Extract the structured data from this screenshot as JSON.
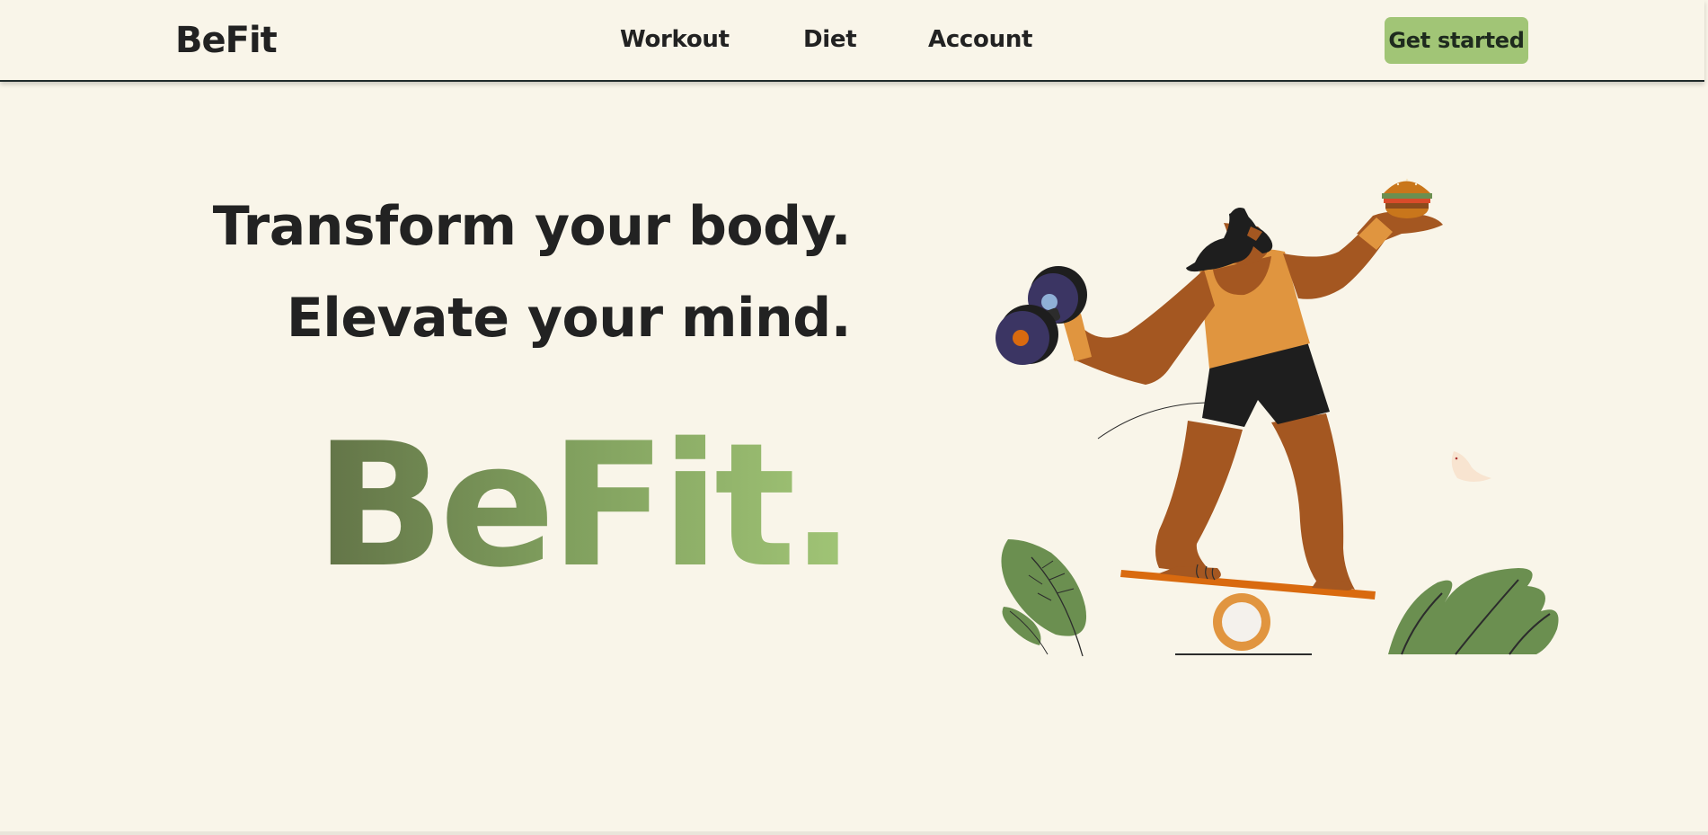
{
  "nav": {
    "brand": "BeFit",
    "links": [
      "Workout",
      "Diet",
      "Account"
    ],
    "cta": "Get started"
  },
  "hero": {
    "line1": "Transform your body.",
    "line2": "Elevate your mind.",
    "brand_large": "BeFit."
  },
  "illustration": {
    "subject": "fitness person on balance board holding dumbbell and burger",
    "icons": [
      "dumbbell-icon",
      "burger-icon",
      "balance-board-icon",
      "leaf-plant-icon",
      "bird-icon"
    ]
  },
  "colors": {
    "background": "#f9f5e9",
    "accent_green": "#a1c576",
    "dark_green": "#627347",
    "text": "#222222",
    "skin": "#a45721",
    "tank_top": "#e0953f",
    "board": "#d96a0f"
  }
}
